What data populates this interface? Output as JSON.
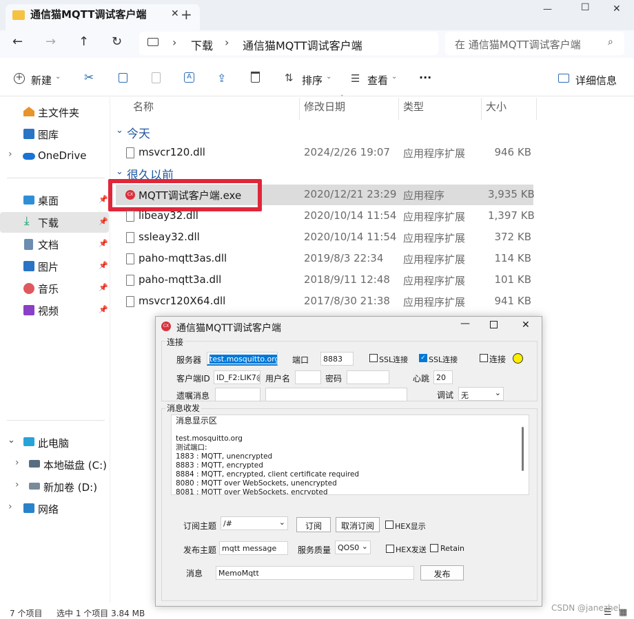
{
  "window": {
    "tab_title": "通信猫MQTT调试客户端",
    "new_tab": "+",
    "controls": {
      "minimize": "—",
      "maximize": "☐",
      "close": "✕"
    }
  },
  "address": {
    "breadcrumb": [
      "下载",
      "通信猫MQTT调试客户端"
    ],
    "search_placeholder": "在 通信猫MQTT调试客户端"
  },
  "toolbar": {
    "new_label": "新建",
    "sort_label": "排序",
    "view_label": "查看",
    "more_label": "···",
    "details_label": "详细信息"
  },
  "sidebar": {
    "top": [
      {
        "label": "主文件夹"
      },
      {
        "label": "图库"
      },
      {
        "label": "OneDrive"
      }
    ],
    "quick": [
      {
        "label": "桌面"
      },
      {
        "label": "下载"
      },
      {
        "label": "文档"
      },
      {
        "label": "图片"
      },
      {
        "label": "音乐"
      },
      {
        "label": "视频"
      }
    ],
    "pc": [
      {
        "label": "此电脑"
      },
      {
        "label": "本地磁盘 (C:)"
      },
      {
        "label": "新加卷 (D:)"
      },
      {
        "label": "网络"
      }
    ]
  },
  "columns": {
    "name": "名称",
    "date": "修改日期",
    "type": "类型",
    "size": "大小"
  },
  "groups": {
    "today": "今天",
    "long_ago": "很久以前"
  },
  "files": [
    {
      "name": "msvcr120.dll",
      "date": "2024/2/26 19:07",
      "type": "应用程序扩展",
      "size": "946 KB"
    },
    {
      "name": "MQTT调试客户端.exe",
      "date": "2020/12/21 23:29",
      "type": "应用程序",
      "size": "3,935 KB"
    },
    {
      "name": "libeay32.dll",
      "date": "2020/10/14 11:54",
      "type": "应用程序扩展",
      "size": "1,397 KB"
    },
    {
      "name": "ssleay32.dll",
      "date": "2020/10/14 11:54",
      "type": "应用程序扩展",
      "size": "372 KB"
    },
    {
      "name": "paho-mqtt3as.dll",
      "date": "2019/8/3 22:34",
      "type": "应用程序扩展",
      "size": "114 KB"
    },
    {
      "name": "paho-mqtt3a.dll",
      "date": "2018/9/11 12:48",
      "type": "应用程序扩展",
      "size": "101 KB"
    },
    {
      "name": "msvcr120X64.dll",
      "date": "2017/8/30 21:38",
      "type": "应用程序扩展",
      "size": "941 KB"
    }
  ],
  "status": {
    "count": "7 个项目",
    "selected": "选中 1 个项目  3.84 MB"
  },
  "watermark": "CSDN @janezhel",
  "dialog": {
    "title": "通信猫MQTT调试客户端",
    "group_conn": "连接",
    "server_label": "服务器",
    "server_value": "test.mosquitto.org",
    "port_label": "端口",
    "port_value": "8883",
    "ssl1_label": "SSL连接",
    "ssl2_label": "SSL连接",
    "connect_label": "连接",
    "clientid_label": "客户端ID",
    "clientid_value": "ID_F2:LIK7@",
    "username_label": "用户名",
    "password_label": "密码",
    "heartbeat_label": "心跳",
    "heartbeat_value": "20",
    "will_label": "遗嘱消息",
    "debug_label": "调试",
    "debug_value": "无",
    "group_msg": "消息收发",
    "log_lines": [
      "消息显示区",
      "",
      "test.mosquitto.org",
      "测试端口:",
      "1883 : MQTT, unencrypted",
      "8883 : MQTT, encrypted",
      "8884 : MQTT, encrypted, client certificate required",
      "8080 : MQTT over WebSockets, unencrypted",
      "8081 : MQTT over WebSockets, encrypted"
    ],
    "sub_topic_label": "订阅主题",
    "sub_topic_value": "/#",
    "subscribe_button": "订阅",
    "unsubscribe_button": "取消订阅",
    "hex_show_label": "HEX显示",
    "pub_topic_label": "发布主题",
    "pub_topic_value": "mqtt message",
    "qos_label": "服务质量",
    "qos_value": "QOS0",
    "hex_send_label": "HEX发送",
    "retain_label": "Retain",
    "message_label": "消息",
    "message_value": "MemoMqtt",
    "publish_button": "发布"
  },
  "colors": {
    "accent": "#1e56a0",
    "highlight": "#e0263a",
    "selected_row": "#dcdcdc",
    "indicator": "#ffee00"
  }
}
